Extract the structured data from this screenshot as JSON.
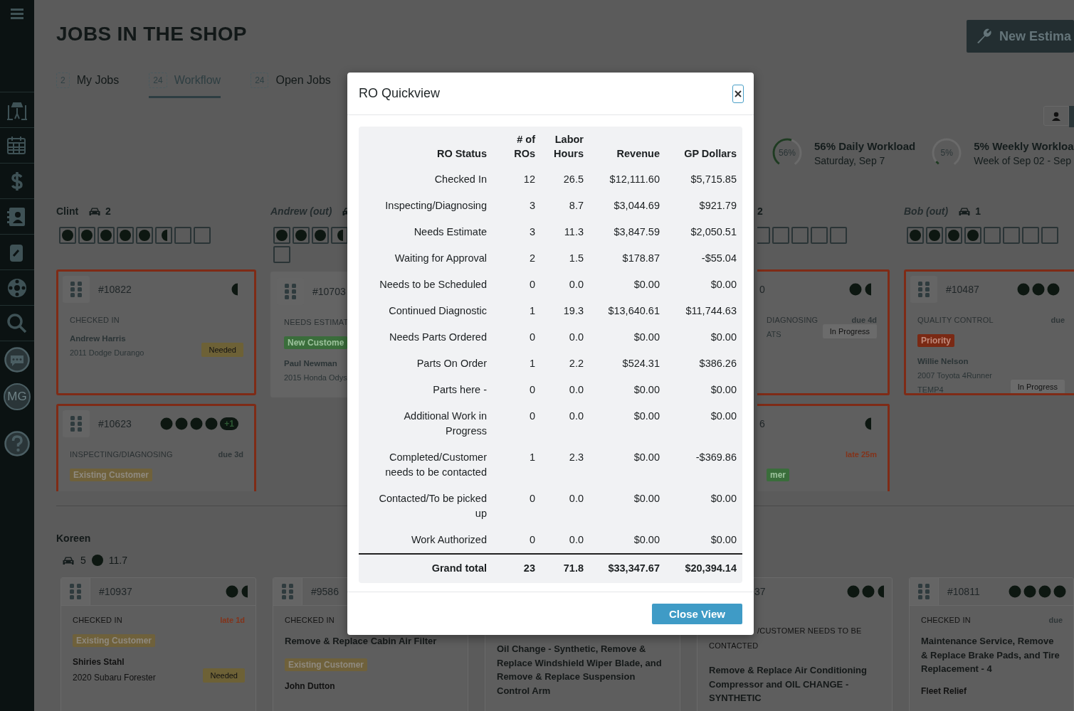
{
  "sidebar": {
    "avatar": "MG"
  },
  "header": {
    "title": "JOBS IN THE SHOP",
    "new_button": "New Estima"
  },
  "tabs": [
    {
      "count": "2",
      "label": "My Jobs",
      "selected": false
    },
    {
      "count": "24",
      "label": "Workflow",
      "selected": true
    },
    {
      "count": "24",
      "label": "Open Jobs",
      "selected": false
    }
  ],
  "workload": [
    {
      "percent": "56%",
      "level": 0.56,
      "title": "56% Daily Workload",
      "subtitle": "Saturday, Sep 7"
    },
    {
      "percent": "5%",
      "level": 0.05,
      "title": "5% Weekly Workloa",
      "subtitle": "Week of Sep 02 - Sep"
    }
  ],
  "technicians": [
    {
      "kind": "full",
      "name": "Clint",
      "out": false,
      "cars": "2",
      "slots": [
        {
          "kind": "full"
        },
        {
          "kind": "full"
        },
        {
          "kind": "full"
        },
        {
          "kind": "full"
        },
        {
          "kind": "full"
        },
        {
          "kind": "half"
        },
        {
          "kind": "empty"
        },
        {
          "kind": "empty"
        }
      ],
      "cards": [
        {
          "number": "#10822",
          "flagged": true,
          "dots": [
            {
              "kind": "half"
            }
          ],
          "status": "CHECKED IN",
          "customer": "Andrew Harris",
          "vehicle": "2011 Dodge Durango",
          "pill": {
            "text": "Needed",
            "kind": "needed"
          }
        },
        {
          "number": "#10623",
          "flagged": true,
          "dots": [
            {
              "kind": "full"
            },
            {
              "kind": "full"
            },
            {
              "kind": "full"
            },
            {
              "kind": "full"
            }
          ],
          "extra": "+1",
          "status": "INSPECTING/DIAGNOSING",
          "due": {
            "text": "due 3d",
            "kind": "due"
          },
          "tag": {
            "text": "Existing Customer",
            "kind": "existing"
          }
        }
      ]
    },
    {
      "kind": "narrow",
      "name": "Andrew (out)",
      "out": true,
      "slots": [
        {
          "kind": "full"
        },
        {
          "kind": "full"
        },
        {
          "kind": "full"
        },
        {
          "kind": "half"
        },
        {
          "kind": "empty"
        }
      ],
      "cards": [
        {
          "number": "#10703",
          "flagged": false,
          "status": "NEEDS ESTIMAT",
          "tag": {
            "text": "New Custome",
            "kind": "new"
          },
          "customer": "Paul Newman",
          "vehicle": "2015 Honda Odys"
        }
      ]
    },
    {
      "kind": "fragment",
      "name": "2",
      "out": false,
      "slots": [
        {
          "kind": "empty"
        },
        {
          "kind": "empty"
        },
        {
          "kind": "empty"
        },
        {
          "kind": "empty"
        },
        {
          "kind": "empty"
        }
      ],
      "cards": [
        {
          "number": "0",
          "flagged": true,
          "dots": [
            {
              "kind": "full"
            },
            {
              "kind": "half"
            }
          ],
          "status": "DIAGNOSING",
          "due": {
            "text": "due 4d",
            "kind": "due"
          },
          "vehicle": "ATS",
          "pill": {
            "text": "In Progress",
            "kind": "progress"
          }
        },
        {
          "number": "6",
          "flagged": true,
          "dots": [
            {
              "kind": "half"
            }
          ],
          "due": {
            "text": "late 25m",
            "kind": "late"
          },
          "tag": {
            "text": "mer",
            "kind": "new"
          }
        }
      ]
    },
    {
      "kind": "edge",
      "name": "Bob (out)",
      "out": true,
      "cars": "1",
      "slots": [
        {
          "kind": "full"
        },
        {
          "kind": "full"
        },
        {
          "kind": "full"
        },
        {
          "kind": "full"
        },
        {
          "kind": "empty"
        },
        {
          "kind": "empty"
        },
        {
          "kind": "empty"
        },
        {
          "kind": "empty"
        }
      ],
      "cards": [
        {
          "number": "#10487",
          "flagged": true,
          "dots": [
            {
              "kind": "full"
            },
            {
              "kind": "full"
            },
            {
              "kind": "full"
            }
          ],
          "status": "QUALITY CONTROL",
          "due": {
            "text": "due",
            "kind": "due"
          },
          "tag": {
            "text": "Priority",
            "kind": "priority"
          },
          "customer": "Willie Nelson",
          "vehicle": "2007 Toyota 4Runner",
          "plate": "TEMP4",
          "pill": {
            "text": "In Progress",
            "kind": "progress"
          }
        }
      ]
    }
  ],
  "group": {
    "name": "Koreen",
    "cars": "5",
    "hours": "11.7",
    "cards": [
      {
        "handle": true,
        "number": "#10937",
        "dots": [
          {
            "kind": "full"
          },
          {
            "kind": "half"
          }
        ],
        "status": "CHECKED IN",
        "due": {
          "text": "late 1d",
          "kind": "late"
        },
        "tag": {
          "text": "Existing Customer",
          "kind": "existing"
        },
        "customer": "Shiries Stahl",
        "vehicle": "2020 Subaru Forester",
        "pill": {
          "text": "Needed",
          "kind": "needed"
        }
      },
      {
        "handle": true,
        "number": "#9586",
        "status": "CHECKED IN",
        "description": "Remove & Replace Cabin Air Filter",
        "tag": {
          "text": "Existing Customer",
          "kind": "existing"
        },
        "customer": "John Dutton"
      },
      {
        "handle": false,
        "description": "Oil Change - Synthetic, Remove & Replace Windshield Wiper Blade, and Remove & Replace Suspension Control Arm"
      },
      {
        "handle": false,
        "number": "37",
        "dots": [
          {
            "kind": "full"
          },
          {
            "kind": "full"
          },
          {
            "kind": "half"
          }
        ],
        "status": "/CUSTOMER NEEDS TO BE CONTACTED",
        "description": "Remove & Replace Air Conditioning Compressor and OIL CHANGE - SYNTHETIC"
      },
      {
        "handle": true,
        "number": "#10811",
        "dots": [
          {
            "kind": "full"
          },
          {
            "kind": "full"
          },
          {
            "kind": "full"
          },
          {
            "kind": "full"
          }
        ],
        "status": "CHECKED IN",
        "due": {
          "text": "due",
          "kind": "due"
        },
        "description": "Maintenance Service, Remove & Replace Brake Pads, and Tire Replacement - 4",
        "customer": "Fleet Relief"
      }
    ]
  },
  "modal": {
    "title": "RO Quickview",
    "columns": [
      "RO Status",
      "# of ROs",
      "Labor Hours",
      "Revenue",
      "GP Dollars"
    ],
    "rows": [
      [
        "Checked In",
        "12",
        "26.5",
        "$12,111.60",
        "$5,715.85"
      ],
      [
        "Inspecting/Diagnosing",
        "3",
        "8.7",
        "$3,044.69",
        "$921.79"
      ],
      [
        "Needs Estimate",
        "3",
        "11.3",
        "$3,847.59",
        "$2,050.51"
      ],
      [
        "Waiting for Approval",
        "2",
        "1.5",
        "$178.87",
        "-$55.04"
      ],
      [
        "Needs to be Scheduled",
        "0",
        "0.0",
        "$0.00",
        "$0.00"
      ],
      [
        "Continued Diagnostic",
        "1",
        "19.3",
        "$13,640.61",
        "$11,744.63"
      ],
      [
        "Needs Parts Ordered",
        "0",
        "0.0",
        "$0.00",
        "$0.00"
      ],
      [
        "Parts On Order",
        "1",
        "2.2",
        "$524.31",
        "$386.26"
      ],
      [
        "Parts here -",
        "0",
        "0.0",
        "$0.00",
        "$0.00"
      ],
      [
        "Additional Work in Progress",
        "0",
        "0.0",
        "$0.00",
        "$0.00"
      ],
      [
        "Completed/Customer needs to be contacted",
        "1",
        "2.3",
        "$0.00",
        "-$369.86"
      ],
      [
        "Contacted/To be picked up",
        "0",
        "0.0",
        "$0.00",
        "$0.00"
      ],
      [
        "Work Authorized",
        "0",
        "0.0",
        "$0.00",
        "$0.00"
      ]
    ],
    "total": [
      "Grand total",
      "23",
      "71.8",
      "$33,347.67",
      "$20,394.14"
    ],
    "close_button": "Close View"
  }
}
